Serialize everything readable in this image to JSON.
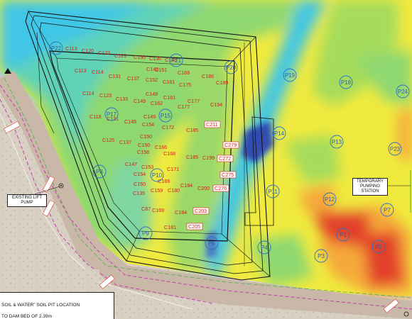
{
  "pit_labels": [
    {
      "text": "C113"
    },
    {
      "text": "C120"
    },
    {
      "text": "C123"
    },
    {
      "text": "C129"
    },
    {
      "text": "C130"
    },
    {
      "text": "C136"
    },
    {
      "text": "C143"
    },
    {
      "text": "C113"
    },
    {
      "text": "C114"
    },
    {
      "text": "C131"
    },
    {
      "text": "C137"
    },
    {
      "text": "C143"
    },
    {
      "text": "C151"
    },
    {
      "text": "C168"
    },
    {
      "text": "C186"
    },
    {
      "text": "C152"
    },
    {
      "text": "C161"
    },
    {
      "text": "C175"
    },
    {
      "text": "C189"
    },
    {
      "text": "C114"
    },
    {
      "text": "C123"
    },
    {
      "text": "C133"
    },
    {
      "text": "C149"
    },
    {
      "text": "C149"
    },
    {
      "text": "C161"
    },
    {
      "text": "C162"
    },
    {
      "text": "C177"
    },
    {
      "text": "C177"
    },
    {
      "text": "C194"
    },
    {
      "text": "C118"
    },
    {
      "text": "C131"
    },
    {
      "text": "C145"
    },
    {
      "text": "C149"
    },
    {
      "text": "C154"
    },
    {
      "text": "C172"
    },
    {
      "text": "C185"
    },
    {
      "text": "C125"
    },
    {
      "text": "C137"
    },
    {
      "text": "C150"
    },
    {
      "text": "C150"
    },
    {
      "text": "C158"
    },
    {
      "text": "C166"
    },
    {
      "text": "C168"
    },
    {
      "text": "C147"
    },
    {
      "text": "C153"
    },
    {
      "text": "C171"
    },
    {
      "text": "C185"
    },
    {
      "text": "C199"
    },
    {
      "text": "C154"
    },
    {
      "text": "C169"
    },
    {
      "text": "C150"
    },
    {
      "text": "C184"
    },
    {
      "text": "C135"
    },
    {
      "text": "C159"
    },
    {
      "text": "C180"
    },
    {
      "text": "C200"
    },
    {
      "text": "C87"
    },
    {
      "text": "C169"
    },
    {
      "text": "C184"
    },
    {
      "text": "C181"
    }
  ],
  "boxed_labels": [
    {
      "text": "C211"
    },
    {
      "text": "C279"
    },
    {
      "text": "C272"
    },
    {
      "text": "C275"
    },
    {
      "text": "C276"
    },
    {
      "text": "C203"
    },
    {
      "text": "C205"
    }
  ],
  "p_markers": [
    {
      "text": "P22"
    },
    {
      "text": "P21"
    },
    {
      "text": "P20"
    },
    {
      "text": "P19"
    },
    {
      "text": "P18"
    },
    {
      "text": "P24"
    },
    {
      "text": "P17"
    },
    {
      "text": "P15"
    },
    {
      "text": "P14"
    },
    {
      "text": "P13"
    },
    {
      "text": "P23"
    },
    {
      "text": "P8"
    },
    {
      "text": "P10"
    },
    {
      "text": "P11"
    },
    {
      "text": "P12"
    },
    {
      "text": "P7"
    },
    {
      "text": "P9"
    },
    {
      "text": "P5"
    },
    {
      "text": "P4"
    },
    {
      "text": "P3"
    },
    {
      "text": "P1"
    },
    {
      "text": "P2"
    }
  ],
  "callouts": {
    "lift_pump": [
      "EXISTING LIFT",
      "PUMP"
    ],
    "pumping_station": [
      "TEMPORARY",
      "PUMPING",
      "STATION"
    ]
  },
  "notes": {
    "line1": "SOIL & WATER\" SOIL PIT LOCATION",
    "line2": "TO DAM BED OF 2.39m"
  },
  "colors": {
    "cyan": "#3fc6e6",
    "teal": "#5fd2b8",
    "green": "#8fd870",
    "yellow": "#f0ea3e",
    "orange": "#f6a83a",
    "red": "#e2402a",
    "dark_blue": "#2b3fae",
    "boundary": "#111111",
    "road_dashed": "#c83cb4"
  }
}
